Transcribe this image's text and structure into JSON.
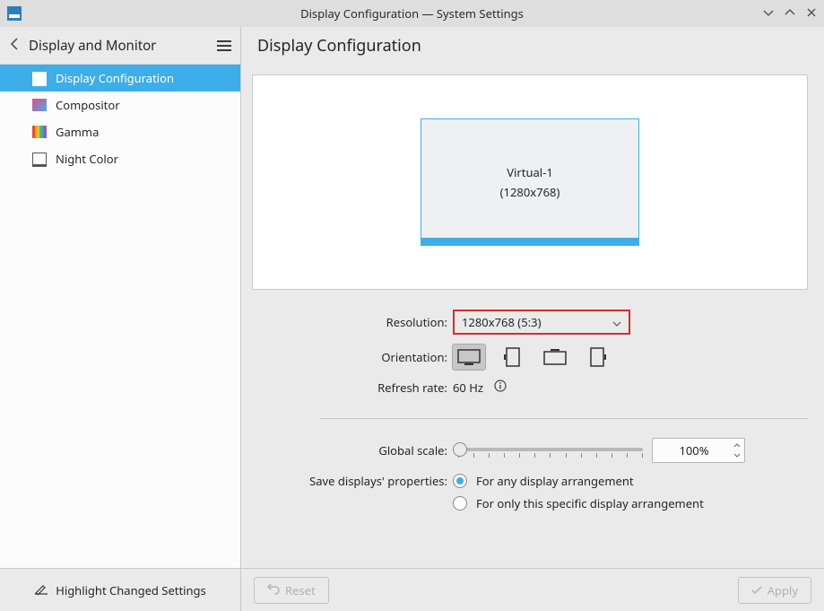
{
  "window": {
    "title": "Display Configuration — System Settings"
  },
  "sidebar": {
    "breadcrumb": "Display and Monitor",
    "items": [
      {
        "label": "Display Configuration"
      },
      {
        "label": "Compositor"
      },
      {
        "label": "Gamma"
      },
      {
        "label": "Night Color"
      }
    ]
  },
  "page": {
    "title": "Display Configuration"
  },
  "monitor": {
    "name": "Virtual-1",
    "resolution_display": "(1280x768)"
  },
  "form": {
    "resolution_label": "Resolution:",
    "resolution_value": "1280x768 (5:3)",
    "orientation_label": "Orientation:",
    "refresh_label": "Refresh rate:",
    "refresh_value": "60 Hz",
    "global_scale_label": "Global scale:",
    "global_scale_value": "100%",
    "save_props_label": "Save displays' properties:",
    "radio_any": "For any display arrangement",
    "radio_specific": "For only this specific display arrangement"
  },
  "footer": {
    "highlight": "Highlight Changed Settings",
    "reset": "Reset",
    "apply": "Apply"
  }
}
